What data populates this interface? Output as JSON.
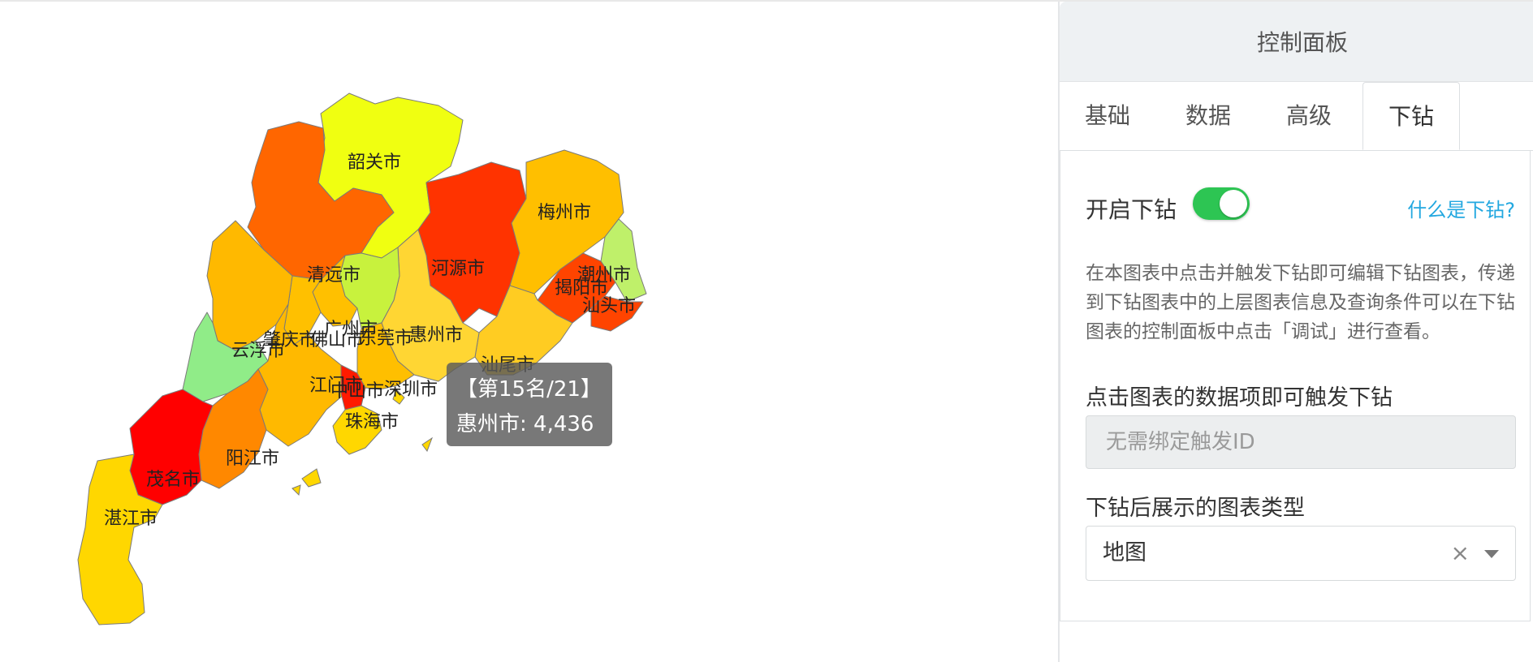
{
  "map": {
    "regions": [
      {
        "name": "韶关市",
        "color": "#f0ff11"
      },
      {
        "name": "清远市",
        "color": "#ff6600"
      },
      {
        "name": "河源市",
        "color": "#ff3300"
      },
      {
        "name": "梅州市",
        "color": "#ffbf00"
      },
      {
        "name": "潮州市",
        "color": "#bff06a"
      },
      {
        "name": "揭阳市",
        "color": "#ff4400"
      },
      {
        "name": "汕头市",
        "color": "#ff4400"
      },
      {
        "name": "汕尾市",
        "color": "#ffcc22"
      },
      {
        "name": "惠州市",
        "color": "#ffd633"
      },
      {
        "name": "东莞市",
        "color": "#c8f23d"
      },
      {
        "name": "广州市",
        "color": "#ffc000"
      },
      {
        "name": "佛山市",
        "color": "#ffc000"
      },
      {
        "name": "肇庆市",
        "color": "#ffb900"
      },
      {
        "name": "云浮市",
        "color": "#90ec88"
      },
      {
        "name": "江门市",
        "color": "#ffb900"
      },
      {
        "name": "中山市",
        "color": "#ff1a00"
      },
      {
        "name": "深圳市",
        "color": "#ffbf00"
      },
      {
        "name": "珠海市",
        "color": "#ffd700"
      },
      {
        "name": "阳江市",
        "color": "#ff8800"
      },
      {
        "name": "茂名市",
        "color": "#ff0000"
      },
      {
        "name": "湛江市",
        "color": "#ffd700"
      }
    ],
    "tooltip": {
      "rank_text": "【第15名/21】",
      "value_text": "惠州市: 4,436"
    }
  },
  "panel": {
    "title": "控制面板",
    "tabs": [
      {
        "label": "基础"
      },
      {
        "label": "数据"
      },
      {
        "label": "高级"
      },
      {
        "label": "下钻"
      }
    ],
    "drill": {
      "toggle_label": "开启下钻",
      "toggle_on": true,
      "help_link": "什么是下钻?",
      "description": "在本图表中点击并触发下钻即可编辑下钻图表，传递到下钻图表中的上层图表信息及查询条件可以在下钻图表的控制面板中点击「调试」进行查看。",
      "trigger_label": "点击图表的数据项即可触发下钻",
      "trigger_placeholder": "无需绑定触发ID",
      "chart_type_label": "下钻后展示的图表类型",
      "chart_type_value": "地图"
    }
  },
  "colors": {
    "accent_green": "#2dc553",
    "link_blue": "#23a8e0",
    "tooltip_bg": "#5a5a5a"
  }
}
